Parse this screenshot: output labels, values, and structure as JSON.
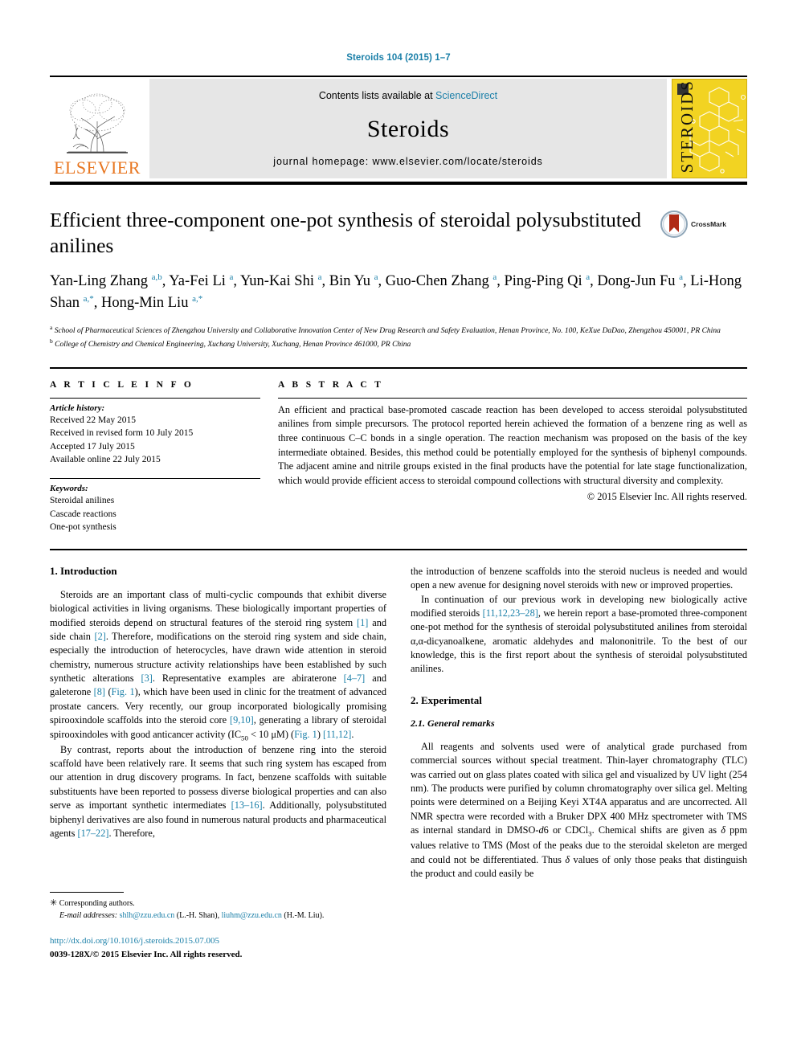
{
  "running_head": "Steroids 104 (2015) 1–7",
  "masthead": {
    "publisher": "ELSEVIER",
    "contents_prefix": "Contents lists available at ",
    "contents_link": "ScienceDirect",
    "journal_name": "Steroids",
    "homepage": "journal homepage: www.elsevier.com/locate/steroids",
    "cover_title": "STEROIDS"
  },
  "article": {
    "title": "Efficient three-component one-pot synthesis of steroidal polysubstituted anilines",
    "crossmark_label": "CrossMark",
    "authors_html": "Yan-Ling Zhang <sup>a,b</sup>, Ya-Fei Li <sup>a</sup>, Yun-Kai Shi <sup>a</sup>, Bin Yu <sup>a</sup>, Guo-Chen Zhang <sup>a</sup>, Ping-Ping Qi <sup>a</sup>, Dong-Jun Fu <sup>a</sup>, Li-Hong Shan <sup>a,*</sup>, Hong-Min Liu <sup>a,*</sup>",
    "affiliation_a": "School of Pharmaceutical Sciences of Zhengzhou University and Collaborative Innovation Center of New Drug Research and Safety Evaluation, Henan Province, No. 100, KeXue DaDao, Zhengzhou 450001, PR China",
    "affiliation_b": "College of Chemistry and Chemical Engineering, Xuchang University, Xuchang, Henan Province 461000, PR China"
  },
  "article_info": {
    "label": "A R T I C L E    I N F O",
    "history_heading": "Article history:",
    "history": [
      "Received 22 May 2015",
      "Received in revised form 10 July 2015",
      "Accepted 17 July 2015",
      "Available online 22 July 2015"
    ],
    "keywords_heading": "Keywords:",
    "keywords": [
      "Steroidal anilines",
      "Cascade reactions",
      "One-pot synthesis"
    ]
  },
  "abstract": {
    "label": "A B S T R A C T",
    "text": "An efficient and practical base-promoted cascade reaction has been developed to access steroidal polysubstituted anilines from simple precursors. The protocol reported herein achieved the formation of a benzene ring as well as three continuous C–C bonds in a single operation. The reaction mechanism was proposed on the basis of the key intermediate obtained. Besides, this method could be potentially employed for the synthesis of biphenyl compounds. The adjacent amine and nitrile groups existed in the final products have the potential for late stage functionalization, which would provide efficient access to steroidal compound collections with structural diversity and complexity.",
    "copyright": "© 2015 Elsevier Inc. All rights reserved."
  },
  "body": {
    "intro_heading": "1. Introduction",
    "intro_p1_html": "Steroids are an important class of multi-cyclic compounds that exhibit diverse biological activities in living organisms. These biologically important properties of modified steroids depend on structural features of the steroid ring system <span class=\"link\">[1]</span> and side chain <span class=\"link\">[2]</span>. Therefore, modifications on the steroid ring system and side chain, especially the introduction of heterocycles, have drawn wide attention in steroid chemistry, numerous structure activity relationships have been established by such synthetic alterations <span class=\"link\">[3]</span>. Representative examples are abiraterone <span class=\"link\">[4–7]</span> and galeterone <span class=\"link\">[8]</span> (<span class=\"link\">Fig. 1</span>), which have been used in clinic for the treatment of advanced prostate cancers. Very recently, our group incorporated biologically promising spirooxindole scaffolds into the steroid core <span class=\"link\">[9,10]</span>, generating a library of steroidal spirooxindoles with good anticancer activity (IC<sub>50</sub> &lt; 10 μM) (<span class=\"link\">Fig. 1</span>) <span class=\"link\">[11,12]</span>.",
    "intro_p2_html": "By contrast, reports about the introduction of benzene ring into the steroid scaffold have been relatively rare. It seems that such ring system has escaped from our attention in drug discovery programs. In fact, benzene scaffolds with suitable substituents have been reported to possess diverse biological properties and can also serve as important synthetic intermediates <span class=\"link\">[13–16]</span>. Additionally, polysubstituted biphenyl derivatives are also found in numerous natural products and pharmaceutical agents <span class=\"link\">[17–22]</span>. Therefore,",
    "intro_p3_html": "the introduction of benzene scaffolds into the steroid nucleus is needed and would open a new avenue for designing novel steroids with new or improved properties.",
    "intro_p4_html": "In continuation of our previous work in developing new biologically active modified steroids <span class=\"link\">[11,12,23–28]</span>, we herein report a base-promoted three-component one-pot method for the synthesis of steroidal polysubstituted anilines from steroidal α,α-dicyanoalkene, aromatic aldehydes and malononitrile. To the best of our knowledge, this is the first report about the synthesis of steroidal polysubstituted anilines.",
    "experimental_heading": "2. Experimental",
    "general_remarks_heading": "2.1. General remarks",
    "general_remarks_html": "All reagents and solvents used were of analytical grade purchased from commercial sources without special treatment. Thin-layer chromatography (TLC) was carried out on glass plates coated with silica gel and visualized by UV light (254 nm). The products were purified by column chromatography over silica gel. Melting points were determined on a Beijing Keyi XT4A apparatus and are uncorrected. All NMR spectra were recorded with a Bruker DPX 400 MHz spectrometer with TMS as internal standard in DMSO-<i>d</i>6 or CDCl<sub>3</sub>. Chemical shifts are given as <i>δ</i> ppm values relative to TMS (Most of the peaks due to the steroidal skeleton are merged and could not be differentiated. Thus <i>δ</i> values of only those peaks that distinguish the product and could easily be"
  },
  "footnotes": {
    "corresponding": "Corresponding authors.",
    "email_label": "E-mail addresses:",
    "email_1": "shlh@zzu.edu.cn",
    "email_1_name": "(L.-H. Shan),",
    "email_2": "liuhm@zzu.edu.cn",
    "email_2_name": "(H.-M. Liu).",
    "doi": "http://dx.doi.org/10.1016/j.steroids.2015.07.005",
    "issn": "0039-128X/© 2015 Elsevier Inc. All rights reserved."
  },
  "colors": {
    "link": "#1a7fa8",
    "elsevier_orange": "#E87722",
    "cover_yellow": "#f2d322",
    "band_gray": "#e6e6e6"
  }
}
